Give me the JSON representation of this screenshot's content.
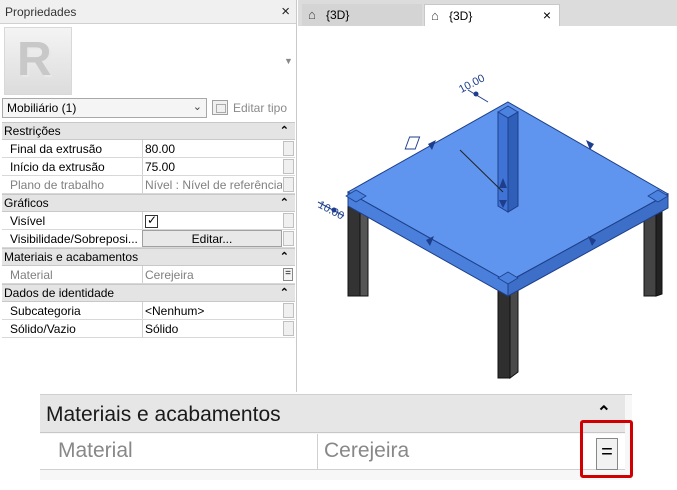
{
  "properties": {
    "title": "Propriedades",
    "close": "×",
    "type_selector": "Mobiliário (1)",
    "edit_type": "Editar tipo",
    "groups": [
      {
        "name": "Restrições",
        "rows": [
          {
            "name": "Final da extrusão",
            "value": "80.00"
          },
          {
            "name": "Início da extrusão",
            "value": "75.00"
          },
          {
            "name": "Plano de trabalho",
            "value": "Nível : Nível de referência"
          }
        ]
      },
      {
        "name": "Gráficos",
        "rows": [
          {
            "name": "Visível",
            "value": ""
          },
          {
            "name": "Visibilidade/Sobreposi...",
            "value": "Editar..."
          }
        ]
      },
      {
        "name": "Materiais e acabamentos",
        "rows": [
          {
            "name": "Material",
            "value": "Cerejeira"
          }
        ]
      },
      {
        "name": "Dados de identidade",
        "rows": [
          {
            "name": "Subcategoria",
            "value": "<Nenhum>"
          },
          {
            "name": "Sólido/Vazio",
            "value": "Sólido"
          }
        ]
      }
    ],
    "collapse_symbol": "⌃"
  },
  "tabs": [
    {
      "label": "{3D}"
    },
    {
      "label": "{3D}",
      "close": "×"
    }
  ],
  "view": {
    "dimension_top": "10.00",
    "dimension_left": "10.00",
    "colors": {
      "tabletop": "#5b8fe8",
      "legs": "#3a3a3a",
      "highlight": "#d00000"
    }
  },
  "zoom": {
    "group": "Materiais e acabamentos",
    "row_name": "Material",
    "row_value": "Cerejeira",
    "eq": "="
  }
}
